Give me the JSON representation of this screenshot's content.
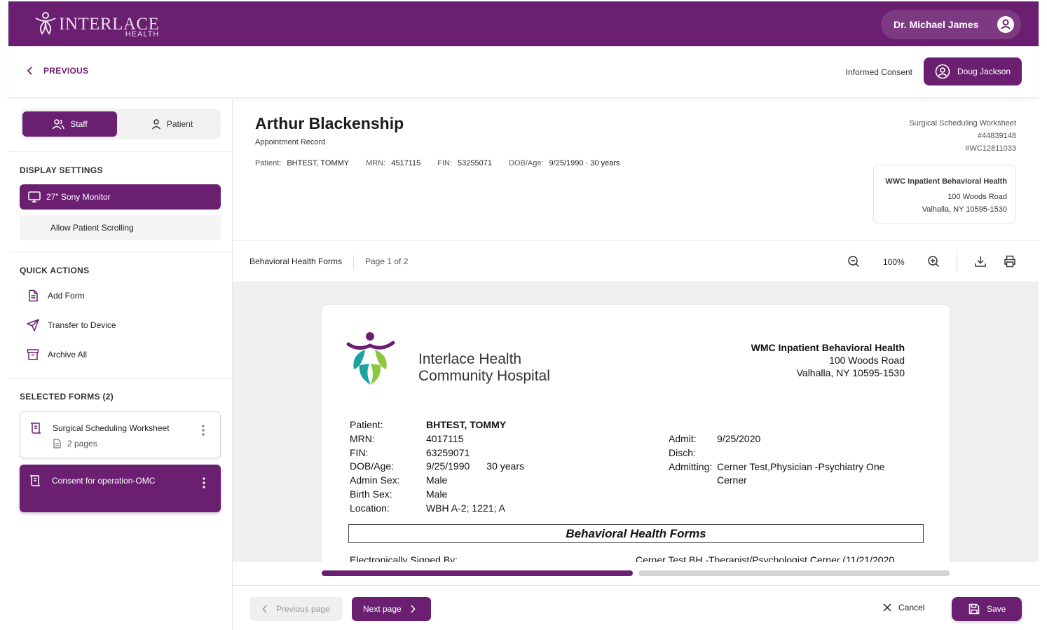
{
  "colors": {
    "brand": "#6a1f70",
    "brand_light": "#7d3a83",
    "progress_inactive": "#d4d4d4"
  },
  "header": {
    "logo_text": "INTERLACE",
    "logo_sub": "HEALTH",
    "user_name": "Dr. Michael James"
  },
  "subbar": {
    "previous_label": "PREVIOUS",
    "context_label": "Informed Consent",
    "patient_button": "Doug Jackson"
  },
  "sidebar": {
    "tabs": [
      {
        "label": "Staff",
        "active": true
      },
      {
        "label": "Patient",
        "active": false
      }
    ],
    "display_settings": {
      "title": "DISPLAY SETTINGS",
      "monitor": "27\" Sony Monitor",
      "scrolling": "Allow Patient Scrolling"
    },
    "quick_actions": {
      "title": "QUICK ACTIONS",
      "items": [
        {
          "label": "Add Form",
          "icon": "file-text-icon"
        },
        {
          "label": "Transfer to Device",
          "icon": "send-icon"
        },
        {
          "label": "Archive All",
          "icon": "archive-icon"
        }
      ]
    },
    "selected_forms": {
      "title": "SELECTED FORMS (2)",
      "items": [
        {
          "title": "Surgical Scheduling Worksheet",
          "pages": "2 pages",
          "selected": false
        },
        {
          "title": "Consent for operation-OMC",
          "selected": true
        }
      ]
    }
  },
  "record": {
    "name": "Arthur Blackenship",
    "type": "Appointment Record",
    "info": [
      {
        "key": "Patient:",
        "value": "BHTEST, TOMMY"
      },
      {
        "key": "MRN:",
        "value": "4517115"
      },
      {
        "key": "FIN:",
        "value": "53255071"
      },
      {
        "key": "DOB/Age:",
        "value": "9/25/1990 · 30 years"
      }
    ],
    "meta": {
      "form_name": "Surgical Scheduling Worksheet",
      "id1": "#44839148",
      "id2": "#WC12811033"
    },
    "location": {
      "name": "WWC Inpatient Behavioral Health",
      "address1": "100 Woods Road",
      "address2": "Valhalla, NY 10595-1530"
    }
  },
  "toolbar": {
    "form_title": "Behavioral Health Forms",
    "page_label": "Page 1 of 2",
    "zoom": "100%"
  },
  "document": {
    "hospital_line1": "Interlace Health",
    "hospital_line2": "Community Hospital",
    "facility": {
      "name": "WMC Inpatient Behavioral Health",
      "address1": "100 Woods Road",
      "address2": "Valhalla, NY 10595-1530"
    },
    "patient_fields": [
      {
        "key": "Patient:",
        "value": "BHTEST, TOMMY",
        "bold": true
      },
      {
        "key": "MRN:",
        "value": "4017115"
      },
      {
        "key": "FIN:",
        "value": "63259071"
      },
      {
        "key": "DOB/Age:",
        "value": "9/25/1990",
        "extra": "30 years"
      },
      {
        "key": "Admin Sex:",
        "value": "Male"
      },
      {
        "key": "Birth Sex:",
        "value": "Male"
      },
      {
        "key": "Location:",
        "value": "WBH A-2; 1221; A"
      }
    ],
    "admit_fields": [
      {
        "key": "Admit:",
        "value": "9/25/2020"
      },
      {
        "key": "Disch:",
        "value": ""
      },
      {
        "key": "Admitting:",
        "value": "Cerner Test,Physician -Psychiatry One",
        "value2": "Cerner"
      }
    ],
    "section_title": "Behavioral Health Forms",
    "signed_by_label": "Electronically Signed By:",
    "signed_by_value": "Cerner Test BH -Therapist/Psychologist Cerner (11/21/2020"
  },
  "progress": {
    "current_page": 1,
    "total_pages": 2
  },
  "footer": {
    "previous_page": "Previous page",
    "next_page": "Next page",
    "cancel": "Cancel",
    "save": "Save"
  }
}
